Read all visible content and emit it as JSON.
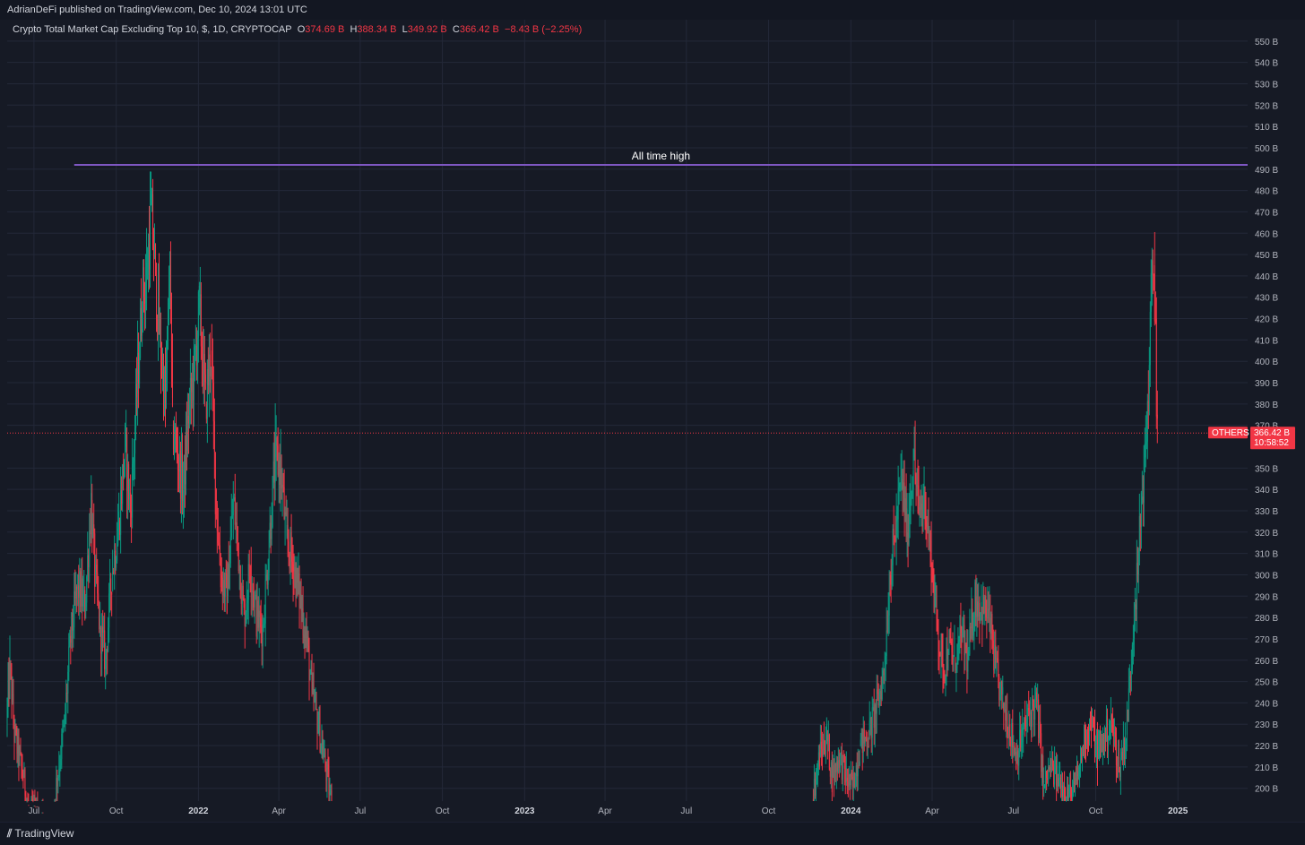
{
  "header": {
    "published": "AdrianDeFi published on TradingView.com, Dec 10, 2024 13:01 UTC"
  },
  "legend": {
    "title": "Crypto Total Market Cap Excluding Top 10, $, 1D, CRYPTOCAP",
    "o_key": "O",
    "o_val": "374.69 B",
    "h_key": "H",
    "h_val": "388.34 B",
    "l_key": "L",
    "l_val": "349.92 B",
    "c_key": "C",
    "c_val": "366.42 B",
    "change": "−8.43 B (−2.25%)"
  },
  "price_tag": {
    "symbol": "OTHERS",
    "value": "366.42 B",
    "countdown": "10:58:52"
  },
  "annotation": {
    "text": "All time high"
  },
  "footer": {
    "brand": "TradingView"
  },
  "colors": {
    "up": "#089981",
    "down": "#f23645",
    "ath_line": "#7e57c2",
    "grid": "#232838",
    "background": "#161a25"
  },
  "chart_data": {
    "type": "candlestick",
    "symbol": "OTHERS",
    "interval": "1D",
    "y_unit": "B",
    "ylim": [
      194,
      560
    ],
    "y_ticks": [
      200,
      210,
      220,
      230,
      240,
      250,
      260,
      270,
      280,
      290,
      300,
      310,
      320,
      330,
      340,
      350,
      370,
      380,
      390,
      400,
      410,
      420,
      430,
      440,
      450,
      460,
      470,
      480,
      490,
      500,
      510,
      520,
      530,
      540,
      550
    ],
    "x_ticks": [
      {
        "label": "Jul",
        "date": "2021-07-01",
        "year": false
      },
      {
        "label": "Oct",
        "date": "2021-10-01",
        "year": false
      },
      {
        "label": "2022",
        "date": "2022-01-01",
        "year": true
      },
      {
        "label": "Apr",
        "date": "2022-04-01",
        "year": false
      },
      {
        "label": "Jul",
        "date": "2022-07-01",
        "year": false
      },
      {
        "label": "Oct",
        "date": "2022-10-01",
        "year": false
      },
      {
        "label": "2023",
        "date": "2023-01-01",
        "year": true
      },
      {
        "label": "Apr",
        "date": "2023-04-01",
        "year": false
      },
      {
        "label": "Jul",
        "date": "2023-07-01",
        "year": false
      },
      {
        "label": "Oct",
        "date": "2023-10-01",
        "year": false
      },
      {
        "label": "2024",
        "date": "2024-01-01",
        "year": true
      },
      {
        "label": "Apr",
        "date": "2024-04-01",
        "year": false
      },
      {
        "label": "Jul",
        "date": "2024-07-01",
        "year": false
      },
      {
        "label": "Oct",
        "date": "2024-10-01",
        "year": false
      },
      {
        "label": "2025",
        "date": "2025-01-01",
        "year": true
      }
    ],
    "x_range": [
      "2021-06-01",
      "2025-03-20"
    ],
    "ath": {
      "value": 492,
      "start": "2021-08-15",
      "label": "All time high"
    },
    "last_price": 366.42,
    "series": [
      {
        "date": "2021-06-01",
        "close": 230
      },
      {
        "date": "2021-06-05",
        "close": 258
      },
      {
        "date": "2021-06-10",
        "close": 225
      },
      {
        "date": "2021-06-15",
        "close": 215
      },
      {
        "date": "2021-06-20",
        "close": 205
      },
      {
        "date": "2021-06-26",
        "close": 190
      },
      {
        "date": "2021-07-10",
        "close": 185
      },
      {
        "date": "2021-07-20",
        "close": 180
      },
      {
        "date": "2021-07-28",
        "close": 205
      },
      {
        "date": "2021-08-05",
        "close": 230
      },
      {
        "date": "2021-08-12",
        "close": 270
      },
      {
        "date": "2021-08-20",
        "close": 295
      },
      {
        "date": "2021-08-28",
        "close": 285
      },
      {
        "date": "2021-09-04",
        "close": 335
      },
      {
        "date": "2021-09-08",
        "close": 300
      },
      {
        "date": "2021-09-14",
        "close": 275
      },
      {
        "date": "2021-09-20",
        "close": 260
      },
      {
        "date": "2021-09-27",
        "close": 300
      },
      {
        "date": "2021-10-05",
        "close": 325
      },
      {
        "date": "2021-10-12",
        "close": 360
      },
      {
        "date": "2021-10-18",
        "close": 330
      },
      {
        "date": "2021-10-25",
        "close": 385
      },
      {
        "date": "2021-10-31",
        "close": 430
      },
      {
        "date": "2021-11-05",
        "close": 440
      },
      {
        "date": "2021-11-10",
        "close": 470
      },
      {
        "date": "2021-11-15",
        "close": 440
      },
      {
        "date": "2021-11-20",
        "close": 410
      },
      {
        "date": "2021-11-26",
        "close": 380
      },
      {
        "date": "2021-12-01",
        "close": 445
      },
      {
        "date": "2021-12-04",
        "close": 370
      },
      {
        "date": "2021-12-10",
        "close": 355
      },
      {
        "date": "2021-12-16",
        "close": 340
      },
      {
        "date": "2021-12-22",
        "close": 375
      },
      {
        "date": "2021-12-28",
        "close": 395
      },
      {
        "date": "2022-01-03",
        "close": 425
      },
      {
        "date": "2022-01-10",
        "close": 380
      },
      {
        "date": "2022-01-16",
        "close": 405
      },
      {
        "date": "2022-01-21",
        "close": 340
      },
      {
        "date": "2022-01-27",
        "close": 300
      },
      {
        "date": "2022-02-03",
        "close": 290
      },
      {
        "date": "2022-02-10",
        "close": 335
      },
      {
        "date": "2022-02-15",
        "close": 315
      },
      {
        "date": "2022-02-22",
        "close": 280
      },
      {
        "date": "2022-03-01",
        "close": 305
      },
      {
        "date": "2022-03-08",
        "close": 280
      },
      {
        "date": "2022-03-15",
        "close": 275
      },
      {
        "date": "2022-03-22",
        "close": 315
      },
      {
        "date": "2022-03-29",
        "close": 355
      },
      {
        "date": "2022-04-04",
        "close": 350
      },
      {
        "date": "2022-04-10",
        "close": 318
      },
      {
        "date": "2022-04-18",
        "close": 305
      },
      {
        "date": "2022-04-25",
        "close": 290
      },
      {
        "date": "2022-05-03",
        "close": 270
      },
      {
        "date": "2022-05-09",
        "close": 245
      },
      {
        "date": "2022-05-14",
        "close": 235
      },
      {
        "date": "2022-05-22",
        "close": 215
      },
      {
        "date": "2022-06-01",
        "close": 190
      },
      {
        "date": "2023-11-20",
        "close": 195
      },
      {
        "date": "2023-11-28",
        "close": 215
      },
      {
        "date": "2023-12-06",
        "close": 225
      },
      {
        "date": "2023-12-12",
        "close": 205
      },
      {
        "date": "2023-12-20",
        "close": 215
      },
      {
        "date": "2023-12-28",
        "close": 205
      },
      {
        "date": "2024-01-04",
        "close": 200
      },
      {
        "date": "2024-01-12",
        "close": 220
      },
      {
        "date": "2024-01-22",
        "close": 225
      },
      {
        "date": "2024-02-01",
        "close": 240
      },
      {
        "date": "2024-02-08",
        "close": 255
      },
      {
        "date": "2024-02-15",
        "close": 300
      },
      {
        "date": "2024-02-22",
        "close": 325
      },
      {
        "date": "2024-02-28",
        "close": 345
      },
      {
        "date": "2024-03-05",
        "close": 320
      },
      {
        "date": "2024-03-12",
        "close": 355
      },
      {
        "date": "2024-03-18",
        "close": 330
      },
      {
        "date": "2024-03-25",
        "close": 335
      },
      {
        "date": "2024-04-01",
        "close": 305
      },
      {
        "date": "2024-04-08",
        "close": 275
      },
      {
        "date": "2024-04-14",
        "close": 255
      },
      {
        "date": "2024-04-20",
        "close": 265
      },
      {
        "date": "2024-04-27",
        "close": 260
      },
      {
        "date": "2024-05-05",
        "close": 270
      },
      {
        "date": "2024-05-12",
        "close": 260
      },
      {
        "date": "2024-05-20",
        "close": 290
      },
      {
        "date": "2024-05-27",
        "close": 285
      },
      {
        "date": "2024-06-05",
        "close": 280
      },
      {
        "date": "2024-06-12",
        "close": 255
      },
      {
        "date": "2024-06-20",
        "close": 240
      },
      {
        "date": "2024-06-27",
        "close": 230
      },
      {
        "date": "2024-07-05",
        "close": 215
      },
      {
        "date": "2024-07-12",
        "close": 225
      },
      {
        "date": "2024-07-20",
        "close": 235
      },
      {
        "date": "2024-07-28",
        "close": 240
      },
      {
        "date": "2024-08-05",
        "close": 200
      },
      {
        "date": "2024-08-12",
        "close": 210
      },
      {
        "date": "2024-08-20",
        "close": 205
      },
      {
        "date": "2024-08-28",
        "close": 200
      },
      {
        "date": "2024-09-05",
        "close": 195
      },
      {
        "date": "2024-09-12",
        "close": 205
      },
      {
        "date": "2024-09-20",
        "close": 225
      },
      {
        "date": "2024-09-27",
        "close": 230
      },
      {
        "date": "2024-10-04",
        "close": 215
      },
      {
        "date": "2024-10-12",
        "close": 225
      },
      {
        "date": "2024-10-20",
        "close": 230
      },
      {
        "date": "2024-10-28",
        "close": 210
      },
      {
        "date": "2024-11-05",
        "close": 225
      },
      {
        "date": "2024-11-10",
        "close": 255
      },
      {
        "date": "2024-11-14",
        "close": 285
      },
      {
        "date": "2024-11-18",
        "close": 300
      },
      {
        "date": "2024-11-22",
        "close": 335
      },
      {
        "date": "2024-11-26",
        "close": 355
      },
      {
        "date": "2024-11-30",
        "close": 385
      },
      {
        "date": "2024-12-03",
        "close": 430
      },
      {
        "date": "2024-12-06",
        "close": 445
      },
      {
        "date": "2024-12-08",
        "close": 420
      },
      {
        "date": "2024-12-09",
        "close": 375
      },
      {
        "date": "2024-12-10",
        "close": 366
      }
    ]
  }
}
